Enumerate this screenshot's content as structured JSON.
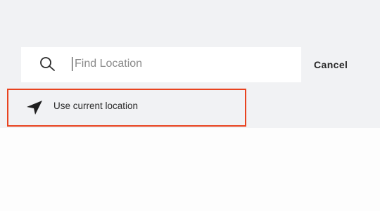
{
  "search": {
    "placeholder": "Find Location",
    "value": "",
    "icon": "search-icon"
  },
  "cancel_label": "Cancel",
  "current_location": {
    "label": "Use current location",
    "icon": "location-arrow-icon",
    "highlight_color": "#e8431f"
  }
}
